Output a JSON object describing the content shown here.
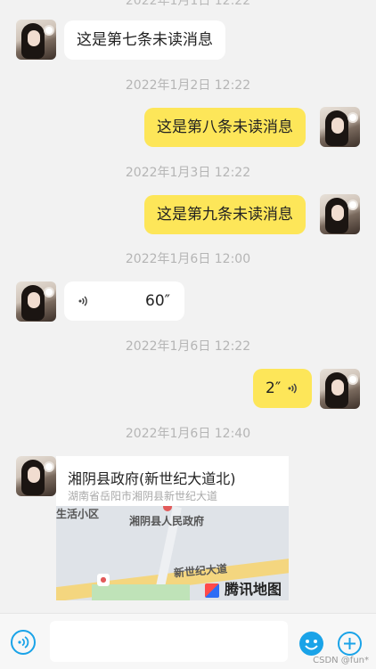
{
  "top_partial_time": "2022年1月1日 12:22",
  "messages": [
    {
      "side": "left",
      "type": "text",
      "text": "这是第七条未读消息"
    },
    {
      "time": "2022年1月2日 12:22",
      "side": "right",
      "type": "text",
      "text": "这是第八条未读消息"
    },
    {
      "time": "2022年1月3日 12:22",
      "side": "right",
      "type": "text",
      "text": "这是第九条未读消息"
    },
    {
      "time": "2022年1月6日 12:00",
      "side": "left",
      "type": "voice",
      "duration": "60″"
    },
    {
      "time": "2022年1月6日 12:22",
      "side": "right",
      "type": "voice",
      "duration": "2″"
    },
    {
      "time": "2022年1月6日 12:40",
      "side": "left",
      "type": "location",
      "title": "湘阴县政府(新世纪大道北)",
      "address": "湖南省岳阳市湘阴县新世纪大道",
      "map_labels": [
        "生活小区",
        "湘阴县人民政府",
        "新世纪大道"
      ],
      "map_brand": "腾讯地图"
    }
  ],
  "input_bar": {
    "placeholder": ""
  },
  "watermark": "CSDN @fun*",
  "colors": {
    "accent": "#1aa3e8",
    "bubble_right": "#fde659",
    "background": "#f2f2f2"
  }
}
